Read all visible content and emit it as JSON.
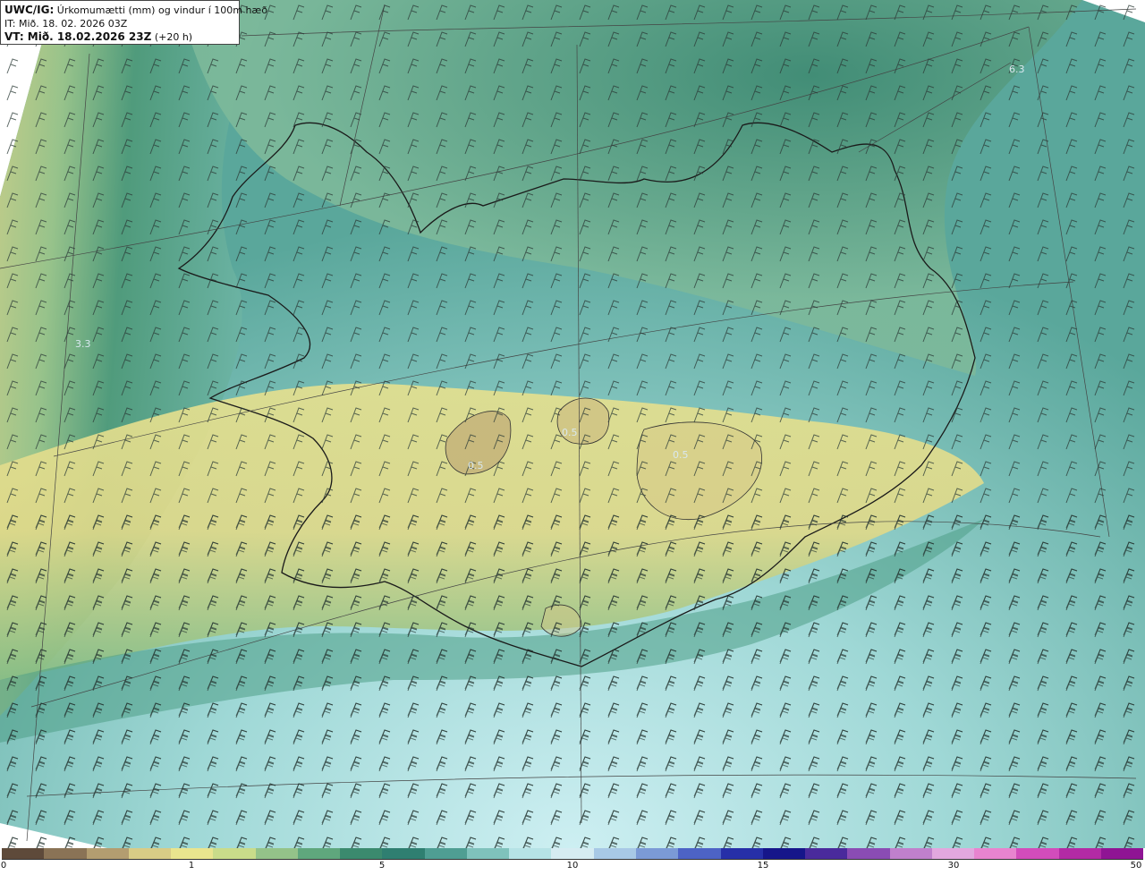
{
  "header": {
    "model": "UWC/IG:",
    "title": "Úrkomumætti (mm) og vindur í 100m hæð",
    "issue_time": "IT: Mið. 18. 02. 2026 03Z",
    "valid_prefix": "VT: Mið. 18.02.2026 23Z",
    "valid_suffix": "(+20 h)"
  },
  "map_labels": [
    "6.3",
    "3.3",
    "0.5",
    "0.5",
    "0.5"
  ],
  "colorbar": {
    "ticks": [
      "0",
      "1",
      "5",
      "10",
      "15",
      "30",
      "50"
    ],
    "colors": [
      "#5e4a3a",
      "#8a7356",
      "#b39d70",
      "#d8cc86",
      "#e9e58e",
      "#c9dc8a",
      "#94c389",
      "#5fa77d",
      "#3b8a6e",
      "#2f7f71",
      "#4f9e93",
      "#7fc2bc",
      "#b6e3e6",
      "#d6ecf2",
      "#a8c9e6",
      "#7b9ad6",
      "#4d63c6",
      "#262fa8",
      "#16168a",
      "#4a2a9c",
      "#8a4cb4",
      "#c080cc",
      "#e2a8de",
      "#e884cf",
      "#d24cbb",
      "#b32aa5",
      "#8f1494"
    ]
  }
}
